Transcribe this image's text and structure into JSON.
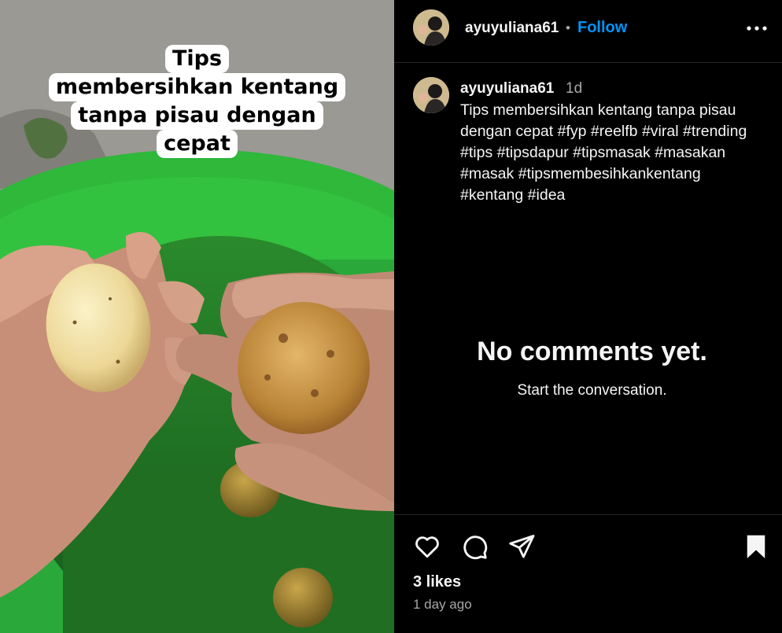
{
  "media": {
    "overlay_lines": [
      "Tips",
      "membersihkan kentang",
      "tanpa pisau dengan",
      "cepat"
    ]
  },
  "header": {
    "username": "ayuyuliana61",
    "separator": "•",
    "follow_label": "Follow",
    "more_icon": "more-horizontal-icon"
  },
  "post": {
    "username": "ayuyuliana61",
    "time": "1d",
    "caption_text": "Tips membersihkan kentang tanpa pisau dengan cepat",
    "hashtags": [
      "#fyp",
      "#reelfb",
      "#viral",
      "#trending",
      "#tips",
      "#tipsdapur",
      "#tipsmasak",
      "#masakan",
      "#masak",
      "#tipsmembesihkankentang",
      "#kentang",
      "#idea"
    ]
  },
  "comments": {
    "empty_title": "No comments yet.",
    "empty_subtitle": "Start the conversation."
  },
  "actions": {
    "icons": [
      "heart-icon",
      "comment-icon",
      "share-icon",
      "bookmark-icon"
    ],
    "likes": "3 likes",
    "posted_ago": "1 day ago"
  },
  "colors": {
    "background": "#000000",
    "accent": "#0095f6",
    "secondary_text": "#a8a8a8",
    "divider": "#262626"
  }
}
